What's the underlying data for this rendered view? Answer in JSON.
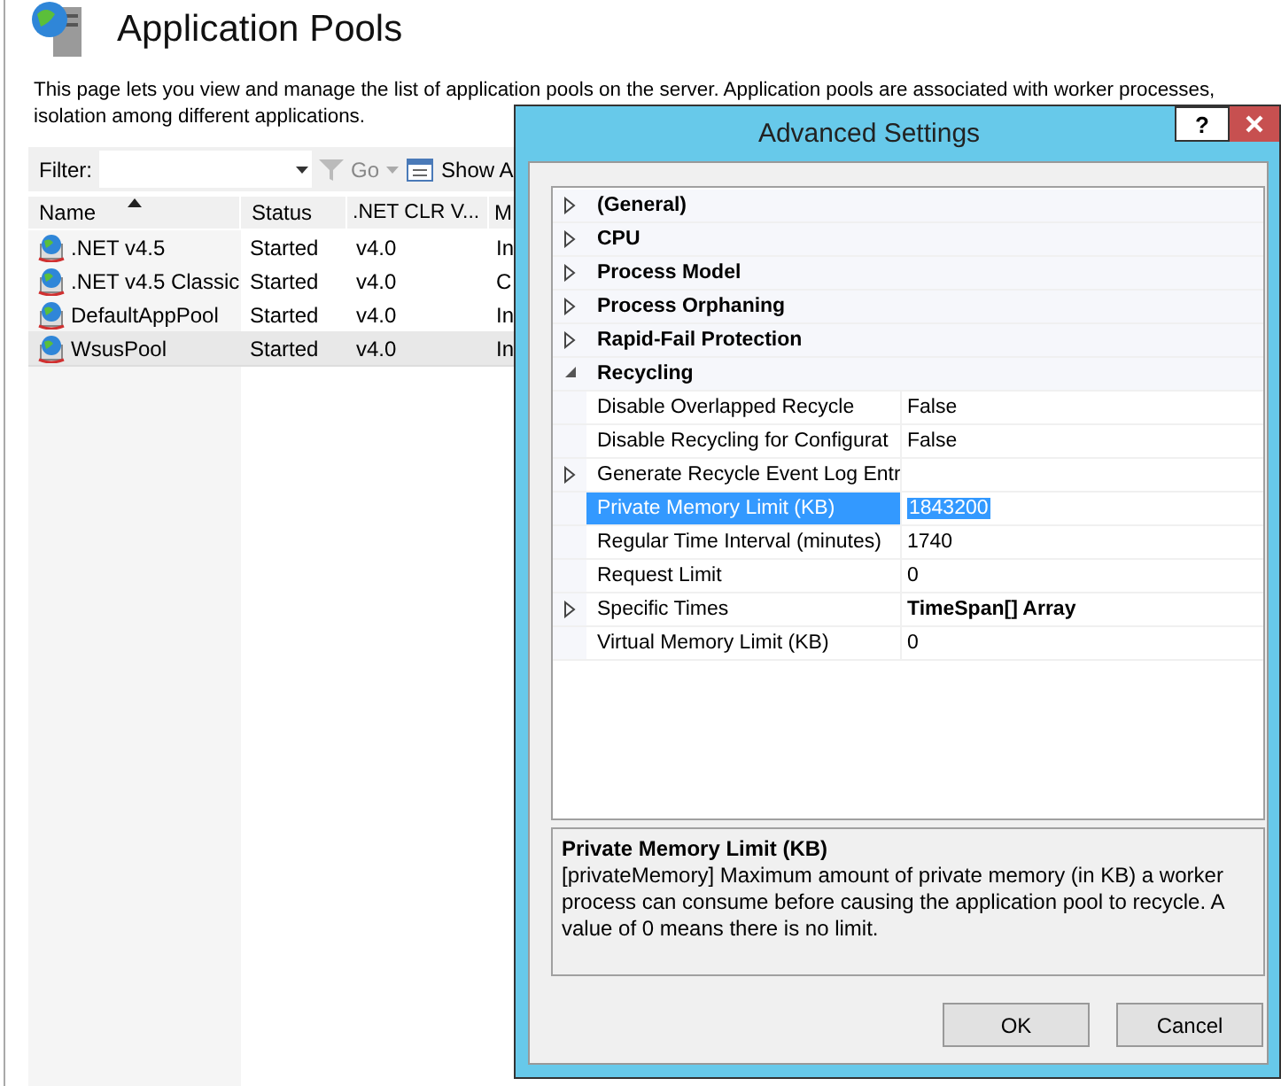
{
  "header": {
    "title": "Application Pools"
  },
  "description": [
    "This page lets you view and manage the list of application pools on the server. Application pools are associated with worker processes,",
    "isolation among different applications."
  ],
  "toolbar": {
    "filter_label": "Filter:",
    "go": "Go",
    "show": "Show A"
  },
  "table": {
    "columns": [
      {
        "label": "Name",
        "sorted": true
      },
      {
        "label": "Status",
        "sorted": false
      },
      {
        "label": ".NET CLR V...",
        "sorted": false
      },
      {
        "label": "M",
        "sorted": false
      }
    ],
    "rows": [
      {
        "cells": [
          ".NET v4.5",
          "Started",
          "v4.0",
          "In"
        ],
        "selected": false
      },
      {
        "cells": [
          ".NET v4.5 Classic",
          "Started",
          "v4.0",
          "C"
        ],
        "selected": false
      },
      {
        "cells": [
          "DefaultAppPool",
          "Started",
          "v4.0",
          "In"
        ],
        "selected": false
      },
      {
        "cells": [
          "WsusPool",
          "Started",
          "v4.0",
          "In"
        ],
        "selected": true
      }
    ]
  },
  "dialog": {
    "title": "Advanced Settings",
    "help": "?",
    "grid": [
      {
        "kind": "category",
        "name": "(General)",
        "expanded": false
      },
      {
        "kind": "category",
        "name": "CPU",
        "expanded": false
      },
      {
        "kind": "category",
        "name": "Process Model",
        "expanded": false
      },
      {
        "kind": "category",
        "name": "Process Orphaning",
        "expanded": false
      },
      {
        "kind": "category",
        "name": "Rapid-Fail Protection",
        "expanded": false
      },
      {
        "kind": "category",
        "name": "Recycling",
        "expanded": true
      },
      {
        "kind": "property",
        "name": "Disable Overlapped Recycle",
        "value": "False",
        "expandable": false,
        "selected": false,
        "emphasized": false
      },
      {
        "kind": "property",
        "name": "Disable Recycling for Configurat",
        "value": "False",
        "expandable": false,
        "selected": false,
        "emphasized": false
      },
      {
        "kind": "property",
        "name": "Generate Recycle Event Log Entr",
        "expandable": true,
        "selected": false,
        "emphasized": false
      },
      {
        "kind": "property",
        "name": "Private Memory Limit (KB)",
        "value": "1843200",
        "expandable": false,
        "selected": true,
        "emphasized": false
      },
      {
        "kind": "property",
        "name": "Regular Time Interval (minutes)",
        "value": "1740",
        "expandable": false,
        "selected": false,
        "emphasized": false
      },
      {
        "kind": "property",
        "name": "Request Limit",
        "value": "0",
        "expandable": false,
        "selected": false,
        "emphasized": false
      },
      {
        "kind": "property",
        "name": "Specific Times",
        "value": "TimeSpan[] Array",
        "expandable": true,
        "selected": false,
        "emphasized": true
      },
      {
        "kind": "property",
        "name": "Virtual Memory Limit (KB)",
        "value": "0",
        "expandable": false,
        "selected": false,
        "emphasized": false
      }
    ],
    "help_panel": {
      "title": "Private Memory Limit (KB)",
      "text": "[privateMemory] Maximum amount of private memory (in KB) a worker process can consume before causing the application pool to recycle.  A value of 0 means there is no limit."
    },
    "buttons": [
      "OK",
      "Cancel"
    ]
  }
}
